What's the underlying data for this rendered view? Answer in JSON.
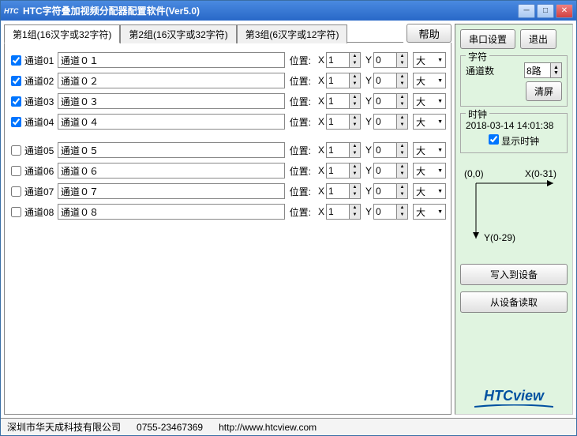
{
  "titlebar": {
    "icon": "HTC",
    "text": "HTC字符叠加视频分配器配置软件(Ver5.0)"
  },
  "tabs": {
    "tab1": "第1组(16汉字或32字符)",
    "tab2": "第2组(16汉字或32字符)",
    "tab3": "第3组(6汉字或12字符)",
    "help": "帮助"
  },
  "row_labels": {
    "pos": "位置:",
    "x": "X",
    "y": "Y"
  },
  "size_options": {
    "big": "大"
  },
  "channels": [
    {
      "checked": true,
      "label": "通道01",
      "name": "通道０１",
      "x": "1",
      "y": "0",
      "size": "大"
    },
    {
      "checked": true,
      "label": "通道02",
      "name": "通道０２",
      "x": "1",
      "y": "0",
      "size": "大"
    },
    {
      "checked": true,
      "label": "通道03",
      "name": "通道０３",
      "x": "1",
      "y": "0",
      "size": "大"
    },
    {
      "checked": true,
      "label": "通道04",
      "name": "通道０４",
      "x": "1",
      "y": "0",
      "size": "大"
    },
    {
      "checked": false,
      "label": "通道05",
      "name": "通道０５",
      "x": "1",
      "y": "0",
      "size": "大"
    },
    {
      "checked": false,
      "label": "通道06",
      "name": "通道０６",
      "x": "1",
      "y": "0",
      "size": "大"
    },
    {
      "checked": false,
      "label": "通道07",
      "name": "通道０７",
      "x": "1",
      "y": "0",
      "size": "大"
    },
    {
      "checked": false,
      "label": "通道08",
      "name": "通道０８",
      "x": "1",
      "y": "0",
      "size": "大"
    }
  ],
  "side": {
    "serial": "串口设置",
    "exit": "退出",
    "char_group": "字符",
    "ch_count_label": "通道数",
    "ch_count_val": "8路",
    "clear": "清屏",
    "clock_group": "时钟",
    "clock_time": "2018-03-14 14:01:38",
    "show_clock": "显示时钟",
    "origin": "(0,0)",
    "xaxis": "X(0-31)",
    "yaxis": "Y(0-29)",
    "write": "写入到设备",
    "read": "从设备读取",
    "logo1": "HTC",
    "logo2": "view"
  },
  "status": {
    "company": "深圳市华天成科技有限公司",
    "phone": "0755-23467369",
    "url": "http://www.htcview.com"
  }
}
